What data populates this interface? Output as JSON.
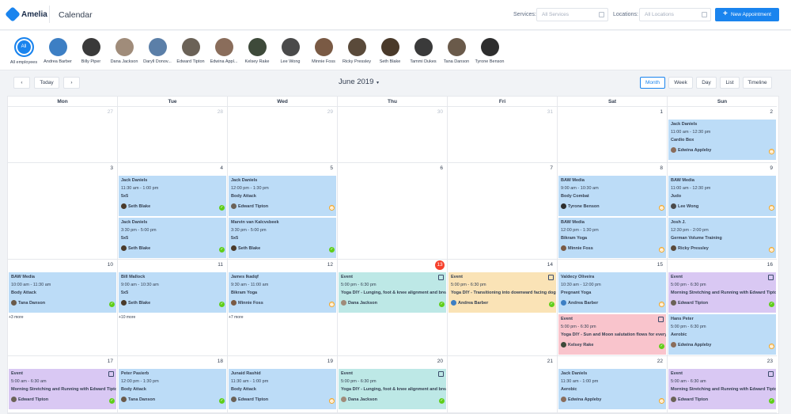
{
  "header": {
    "logo_text": "Amelia",
    "title": "Calendar",
    "services_label": "Services:",
    "services_placeholder": "All Services",
    "locations_label": "Locations:",
    "locations_placeholder": "All Locations",
    "new_button": "New Appointment"
  },
  "employees": [
    {
      "name": "All employees",
      "avatar": "All",
      "color": "#1a84ee"
    },
    {
      "name": "Andrea Barber",
      "color": "#3d7fc4"
    },
    {
      "name": "Billy Piper",
      "color": "#3a3a3a"
    },
    {
      "name": "Dana Jackson",
      "color": "#a08c7a"
    },
    {
      "name": "Daryll Donov...",
      "color": "#5b7fa8"
    },
    {
      "name": "Edward Tipton",
      "color": "#6b6257"
    },
    {
      "name": "Edwina Appl...",
      "color": "#8a6d5b"
    },
    {
      "name": "Kelsey Rake",
      "color": "#3e4a3a"
    },
    {
      "name": "Lee Wong",
      "color": "#4a4a4a"
    },
    {
      "name": "Minnie Foss",
      "color": "#7a5a44"
    },
    {
      "name": "Ricky Pressley",
      "color": "#5a4a3a"
    },
    {
      "name": "Seth Blake",
      "color": "#4a3a2a"
    },
    {
      "name": "Tammi Dukes",
      "color": "#3a3a3a"
    },
    {
      "name": "Tana Danson",
      "color": "#6a5a4a"
    },
    {
      "name": "Tyrone Benson",
      "color": "#2e2e2e"
    }
  ],
  "toolbar": {
    "prev": "‹",
    "today": "Today",
    "next": "›",
    "month_title": "June 2019",
    "caret": "▾",
    "views": [
      "Month",
      "Week",
      "Day",
      "List",
      "Timeline"
    ],
    "active_view": "Month"
  },
  "weekdays": [
    "Mon",
    "Tue",
    "Wed",
    "Thu",
    "Fri",
    "Sat",
    "Sun"
  ],
  "weeks": [
    {
      "days": [
        {
          "n": "27",
          "muted": true
        },
        {
          "n": "28",
          "muted": true
        },
        {
          "n": "29",
          "muted": true
        },
        {
          "n": "30",
          "muted": true
        },
        {
          "n": "31",
          "muted": true
        },
        {
          "n": "1"
        },
        {
          "n": "2"
        }
      ]
    },
    {
      "days": [
        {
          "n": "3"
        },
        {
          "n": "4"
        },
        {
          "n": "5"
        },
        {
          "n": "6"
        },
        {
          "n": "7"
        },
        {
          "n": "8"
        },
        {
          "n": "9"
        }
      ]
    },
    {
      "days": [
        {
          "n": "10"
        },
        {
          "n": "11"
        },
        {
          "n": "12"
        },
        {
          "n": "13",
          "today": true
        },
        {
          "n": "14"
        },
        {
          "n": "15"
        },
        {
          "n": "16"
        }
      ]
    },
    {
      "days": [
        {
          "n": "17"
        },
        {
          "n": "18"
        },
        {
          "n": "19"
        },
        {
          "n": "20"
        },
        {
          "n": "21"
        },
        {
          "n": "22"
        },
        {
          "n": "23"
        }
      ]
    }
  ],
  "events": [
    {
      "week": 0,
      "day": 6,
      "slot": 0,
      "title": "Jack Daniels",
      "time": "11:00 am - 12:30 pm",
      "service": "Cardio Box",
      "person": "Edwina Appleby",
      "status": "wait",
      "color": "#bcdcf7",
      "pc": "#8a6d5b"
    },
    {
      "week": 1,
      "day": 1,
      "slot": 0,
      "title": "Jack Daniels",
      "time": "11:30 am - 1:00 pm",
      "service": "5x5",
      "person": "Seth Blake",
      "status": "ok",
      "color": "#bcdcf7",
      "pc": "#4a3a2a"
    },
    {
      "week": 1,
      "day": 1,
      "slot": 1,
      "title": "Jack Daniels",
      "time": "3:30 pm - 5:00 pm",
      "service": "5x5",
      "person": "Seth Blake",
      "status": "ok",
      "color": "#bcdcf7",
      "pc": "#4a3a2a"
    },
    {
      "week": 1,
      "day": 2,
      "slot": 0,
      "title": "Jack Daniels",
      "time": "12:00 pm - 1:30 pm",
      "service": "Body Attack",
      "person": "Edward Tipton",
      "status": "wait",
      "color": "#bcdcf7",
      "pc": "#6b6257"
    },
    {
      "week": 1,
      "day": 2,
      "slot": 1,
      "title": "Marvin van Kalcvsbeek",
      "time": "3:30 pm - 5:00 pm",
      "service": "5x5",
      "person": "Seth Blake",
      "status": "ok",
      "color": "#bcdcf7",
      "pc": "#4a3a2a"
    },
    {
      "week": 1,
      "day": 5,
      "slot": 0,
      "title": "BAW Media",
      "time": "9:00 am - 10:30 am",
      "service": "Body Combat",
      "person": "Tyrone Benson",
      "status": "wait",
      "color": "#bcdcf7",
      "pc": "#2e2e2e"
    },
    {
      "week": 1,
      "day": 5,
      "slot": 1,
      "title": "BAW Media",
      "time": "12:00 pm - 1:30 pm",
      "service": "Bikram Yoga",
      "person": "Minnie Foss",
      "status": "wait",
      "color": "#bcdcf7",
      "pc": "#7a5a44"
    },
    {
      "week": 1,
      "day": 6,
      "slot": 0,
      "title": "BAW Media",
      "time": "11:00 am - 12:30 pm",
      "service": "Judo",
      "person": "Lee Wong",
      "status": "wait",
      "color": "#bcdcf7",
      "pc": "#4a4a4a"
    },
    {
      "week": 1,
      "day": 6,
      "slot": 1,
      "title": "Josh J.",
      "time": "12:30 pm - 2:00 pm",
      "service": "German Volume Training",
      "person": "Ricky Pressley",
      "status": "wait",
      "color": "#bcdcf7",
      "pc": "#5a4a3a"
    },
    {
      "week": 2,
      "day": 0,
      "slot": 0,
      "title": "BAW Media",
      "time": "10:00 am - 11:30 am",
      "service": "Body Attack",
      "person": "Tana Danson",
      "status": "ok",
      "color": "#bcdcf7",
      "pc": "#6a5a4a"
    },
    {
      "week": 2,
      "day": 1,
      "slot": 0,
      "title": "Bill Mallock",
      "time": "9:00 am - 10:30 am",
      "service": "5x5",
      "person": "Seth Blake",
      "status": "ok",
      "color": "#bcdcf7",
      "pc": "#4a3a2a"
    },
    {
      "week": 2,
      "day": 2,
      "slot": 0,
      "title": "James Ikadqf",
      "time": "9:30 am - 11:00 am",
      "service": "Bikram Yoga",
      "person": "Minnie Foss",
      "status": "wait",
      "color": "#bcdcf7",
      "pc": "#7a5a44"
    },
    {
      "week": 2,
      "day": 3,
      "slot": 0,
      "title": "Event",
      "time": "5:00 pm - 6:30 pm",
      "service": "Yoga DIY - Lunging, foot & knee alignment and brea...",
      "person": "Dana Jackson",
      "status": "ok",
      "color": "#bde8e6",
      "pc": "#a08c7a",
      "ev": true
    },
    {
      "week": 2,
      "day": 4,
      "slot": 0,
      "title": "Event",
      "time": "5:00 pm - 6:30 pm",
      "service": "Yoga DIY - Transitioning into downward facing dog",
      "person": "Andrea Barber",
      "status": "ok",
      "color": "#fae3b6",
      "pc": "#3d7fc4",
      "ev": true
    },
    {
      "week": 2,
      "day": 5,
      "slot": 0,
      "title": "Valdecy Oliveira",
      "time": "10:30 am - 12:00 pm",
      "service": "Pregnant Yoga",
      "person": "Andrea Barber",
      "status": "wait",
      "color": "#bcdcf7",
      "pc": "#3d7fc4"
    },
    {
      "week": 2,
      "day": 5,
      "slot": 1,
      "title": "Event",
      "time": "5:00 pm - 6:30 pm",
      "service": "Yoga DIY - Sun and Moon salutation flows for every ...",
      "person": "Kelsey Rake",
      "status": "ok",
      "color": "#f9c4cc",
      "pc": "#3e4a3a",
      "ev": true
    },
    {
      "week": 2,
      "day": 6,
      "slot": 0,
      "title": "Event",
      "time": "5:00 pm - 6:30 pm",
      "service": "Morning Stretching and Running with Edward Tipton",
      "person": "Edward Tipton",
      "status": "ok",
      "color": "#d9c8f3",
      "pc": "#6b6257",
      "ev": true
    },
    {
      "week": 2,
      "day": 6,
      "slot": 1,
      "title": "Hans Peter",
      "time": "5:00 pm - 6:30 pm",
      "service": "Aerobic",
      "person": "Edwina Appleby",
      "status": "wait",
      "color": "#bcdcf7",
      "pc": "#8a6d5b"
    },
    {
      "week": 3,
      "day": 0,
      "slot": 0,
      "title": "Event",
      "time": "5:00 am - 6:30 am",
      "service": "Morning Stretching and Running with Edward Tipton",
      "person": "Edward Tipton",
      "status": "ok",
      "color": "#d9c8f3",
      "pc": "#6b6257",
      "ev": true
    },
    {
      "week": 3,
      "day": 1,
      "slot": 0,
      "title": "Peter Pasierb",
      "time": "12:00 pm - 1:30 pm",
      "service": "Body Attack",
      "person": "Tana Danson",
      "status": "ok",
      "color": "#bcdcf7",
      "pc": "#6a5a4a"
    },
    {
      "week": 3,
      "day": 2,
      "slot": 0,
      "title": "Junaid Rashid",
      "time": "11:30 am - 1:00 pm",
      "service": "Body Attack",
      "person": "Edward Tipton",
      "status": "wait",
      "color": "#bcdcf7",
      "pc": "#6b6257"
    },
    {
      "week": 3,
      "day": 3,
      "slot": 0,
      "title": "Event",
      "time": "5:00 pm - 6:30 pm",
      "service": "Yoga DIY - Lunging, foot & knee alignment and brea...",
      "person": "Dana Jackson",
      "status": "ok",
      "color": "#bde8e6",
      "pc": "#a08c7a",
      "ev": true
    },
    {
      "week": 3,
      "day": 5,
      "slot": 0,
      "title": "Jack Daniels",
      "time": "11:30 am - 1:00 pm",
      "service": "Aerobic",
      "person": "Edwina Appleby",
      "status": "wait",
      "color": "#bcdcf7",
      "pc": "#8a6d5b"
    },
    {
      "week": 3,
      "day": 6,
      "slot": 0,
      "title": "Event",
      "time": "5:00 am - 6:30 am",
      "service": "Morning Stretching and Running with Edward Tipton",
      "person": "Edward Tipton",
      "status": "ok",
      "color": "#d9c8f3",
      "pc": "#6b6257",
      "ev": true
    }
  ],
  "more_links": [
    {
      "week": 2,
      "day": 0,
      "label": "+3 more"
    },
    {
      "week": 2,
      "day": 1,
      "label": "+10 more"
    },
    {
      "week": 2,
      "day": 2,
      "label": "+7 more"
    }
  ],
  "status_glyphs": {
    "ok": "✓",
    "wait": "◷"
  },
  "colors": {
    "accent": "#1a84ee",
    "today": "#f6412d",
    "approved": "#5fce19",
    "pending": "#f5a623"
  }
}
